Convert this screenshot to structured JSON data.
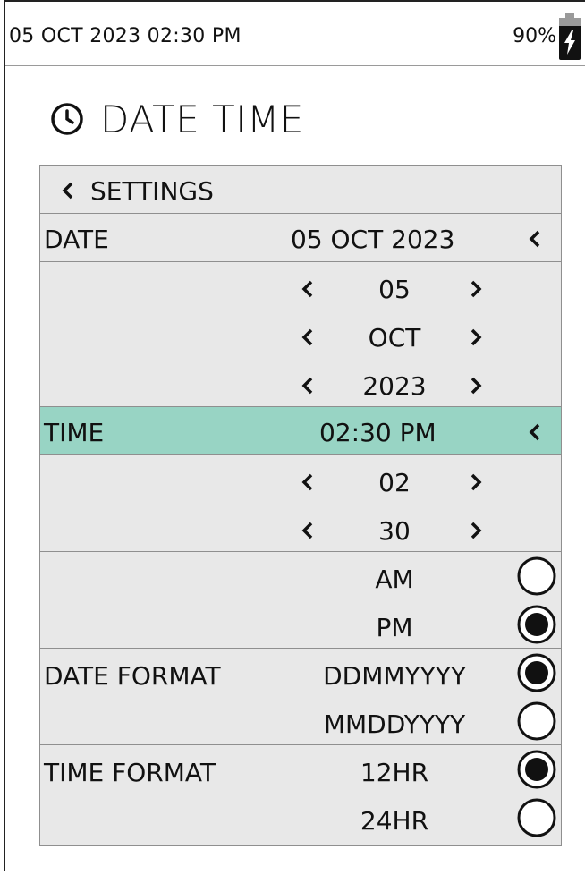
{
  "status": {
    "datetime": "05 OCT 2023 02:30 PM",
    "battery": "90%"
  },
  "page": {
    "title": "DATE TIME",
    "icon": "clock-icon"
  },
  "nav": {
    "back_label": "SETTINGS"
  },
  "date": {
    "label": "DATE",
    "value": "05 OCT 2023",
    "day": "05",
    "month": "OCT",
    "year": "2023"
  },
  "time": {
    "label": "TIME",
    "value": "02:30 PM",
    "hour": "02",
    "minute": "30",
    "am_label": "AM",
    "pm_label": "PM",
    "selected_period": "PM"
  },
  "date_format": {
    "label": "DATE FORMAT",
    "options": [
      "DDMMYYYY",
      "MMDDYYYY"
    ],
    "selected": "DDMMYYYY"
  },
  "time_format": {
    "label": "TIME FORMAT",
    "options": [
      "12HR",
      "24HR"
    ],
    "selected": "12HR"
  },
  "colors": {
    "highlight": "#98d4c4",
    "panel": "#e8e8e8",
    "border": "#8f8f8f"
  }
}
